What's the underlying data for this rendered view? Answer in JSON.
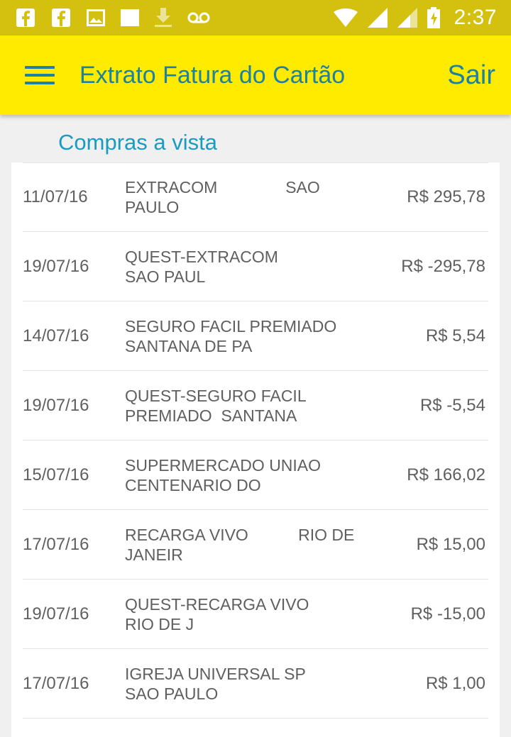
{
  "status_bar": {
    "time": "2:37",
    "left_icons": [
      "facebook-icon",
      "facebook-icon",
      "image-icon",
      "square-icon",
      "download-icon",
      "voicemail-icon"
    ],
    "right_icons": [
      "wifi-icon",
      "signal-icon",
      "signal-icon",
      "battery-charging-icon"
    ]
  },
  "app_bar": {
    "title": "Extrato Fatura do Cartão",
    "logout_label": "Sair"
  },
  "section": {
    "title": "Compras a vista"
  },
  "transactions": [
    {
      "date": "11/07/16",
      "description": "EXTRACOM               SAO\nPAULO",
      "amount": "R$ 295,78"
    },
    {
      "date": "19/07/16",
      "description": "QUEST-EXTRACOM\nSAO PAUL",
      "amount": "R$ -295,78"
    },
    {
      "date": "14/07/16",
      "description": "SEGURO FACIL PREMIADO\nSANTANA DE PA",
      "amount": "R$ 5,54"
    },
    {
      "date": "19/07/16",
      "description": "QUEST-SEGURO FACIL\nPREMIADO  SANTANA",
      "amount": "R$ -5,54"
    },
    {
      "date": "15/07/16",
      "description": "SUPERMERCADO UNIAO\nCENTENARIO DO",
      "amount": "R$ 166,02"
    },
    {
      "date": "17/07/16",
      "description": "RECARGA VIVO           RIO DE\nJANEIR",
      "amount": "R$ 15,00"
    },
    {
      "date": "19/07/16",
      "description": "QUEST-RECARGA VIVO\nRIO DE J",
      "amount": "R$ -15,00"
    },
    {
      "date": "17/07/16",
      "description": "IGREJA UNIVERSAL SP\nSAO PAULO",
      "amount": "R$ 1,00"
    }
  ]
}
